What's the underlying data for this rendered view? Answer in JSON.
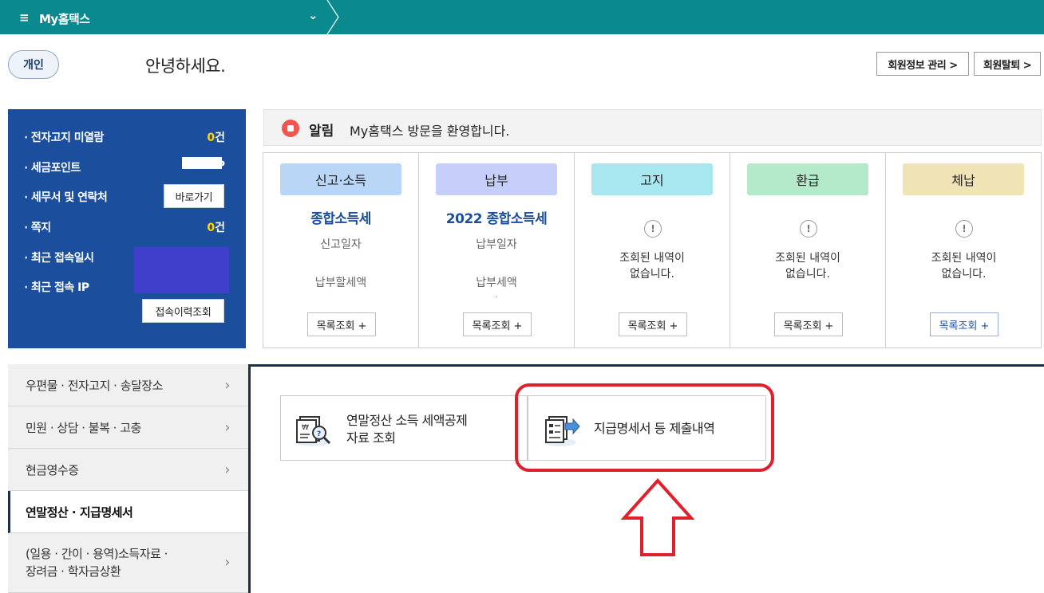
{
  "topbar": {
    "menu_icon": "≡",
    "title": "My홈택스",
    "chevron": "⌄"
  },
  "header": {
    "type_badge": "개인",
    "greeting": "안녕하세요.",
    "member_info_button": "회원정보 관리 >",
    "withdraw_button": "회원탈퇴 >"
  },
  "summary": {
    "rows": [
      {
        "label": "전자고지 미열람",
        "count": "0",
        "unit": "건"
      },
      {
        "label": "세금포인트",
        "value": "P"
      },
      {
        "label": "세무서 및 연락처"
      },
      {
        "label": "쪽지",
        "count": "0",
        "unit": "건"
      },
      {
        "label": "최근 접속일시"
      },
      {
        "label": "최근 접속 IP"
      }
    ],
    "go_button": "바로가기",
    "history_button": "접속이력조회"
  },
  "notice": {
    "label": "알림",
    "text": "My홈택스 방문을 환영합니다."
  },
  "cards": [
    {
      "title": "신고·소득",
      "color": "#b9d6f7",
      "subtitle": "종합소득세",
      "line1": "신고일자",
      "line2": "납부할세액",
      "button": "목록조회 +"
    },
    {
      "title": "납부",
      "color": "#c6cffa",
      "subtitle": "2022 종합소득세",
      "line1": "납부일자",
      "line2": "납부세액",
      "line3": "·",
      "button": "목록조회 +"
    },
    {
      "title": "고지",
      "color": "#a7e7ef",
      "empty_line1": "조회된 내역이",
      "empty_line2": "없습니다.",
      "button": "목록조회 +"
    },
    {
      "title": "환급",
      "color": "#b4e9c9",
      "empty_line1": "조회된 내역이",
      "empty_line2": "없습니다.",
      "button": "목록조회 +"
    },
    {
      "title": "체납",
      "color": "#f0e3b6",
      "empty_line1": "조회된 내역이",
      "empty_line2": "없습니다.",
      "button": "목록조회 +"
    }
  ],
  "menu": {
    "items": [
      {
        "label": "우편물 · 전자고지 · 송달장소"
      },
      {
        "label": "민원 · 상담 · 불복 · 고충"
      },
      {
        "label": "현금영수증"
      },
      {
        "label": "연말정산 · 지급명세서"
      },
      {
        "label_line1": "(일용 · 간이 · 용역)소득자료 ·",
        "label_line2": "장려금 · 학자금상환"
      }
    ]
  },
  "panel": {
    "card1_line1": "연말정산 소득 세액공제",
    "card1_line2": "자료 조회",
    "card2_text": "지급명세서 등 제출내역"
  }
}
